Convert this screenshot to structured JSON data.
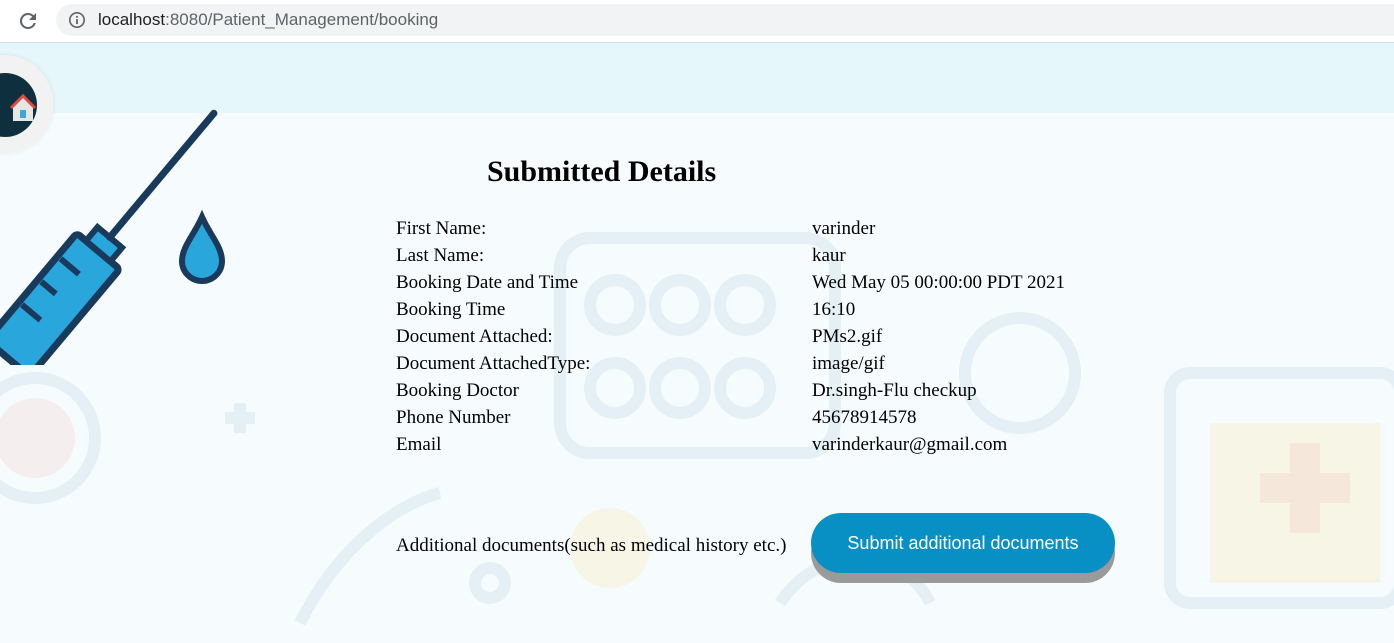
{
  "browser": {
    "url_host": "localhost",
    "url_path": ":8080/Patient_Management/booking"
  },
  "page": {
    "title": "Submitted Details",
    "details": [
      {
        "label": "First Name:",
        "value": "varinder"
      },
      {
        "label": "Last Name:",
        "value": "kaur"
      },
      {
        "label": "Booking Date and Time",
        "value": "Wed May 05 00:00:00 PDT 2021"
      },
      {
        "label": "Booking Time",
        "value": "16:10"
      },
      {
        "label": "Document Attached:",
        "value": "PMs2.gif"
      },
      {
        "label": "Document AttachedType:",
        "value": "image/gif"
      },
      {
        "label": "Booking Doctor",
        "value": "Dr.singh-Flu checkup"
      },
      {
        "label": "Phone Number",
        "value": "45678914578"
      },
      {
        "label": "Email",
        "value": "varinderkaur@gmail.com"
      }
    ],
    "additional_label": "Additional documents(such as medical history etc.)",
    "submit_button_label": "Submit additional documents"
  },
  "colors": {
    "button": "#0890c4",
    "button_text": "#ffffff",
    "background": "#f6fcfd"
  },
  "icons": {
    "reload": "reload-icon",
    "info": "info-icon",
    "logo": "clinic-logo",
    "syringe": "syringe-illustration"
  }
}
